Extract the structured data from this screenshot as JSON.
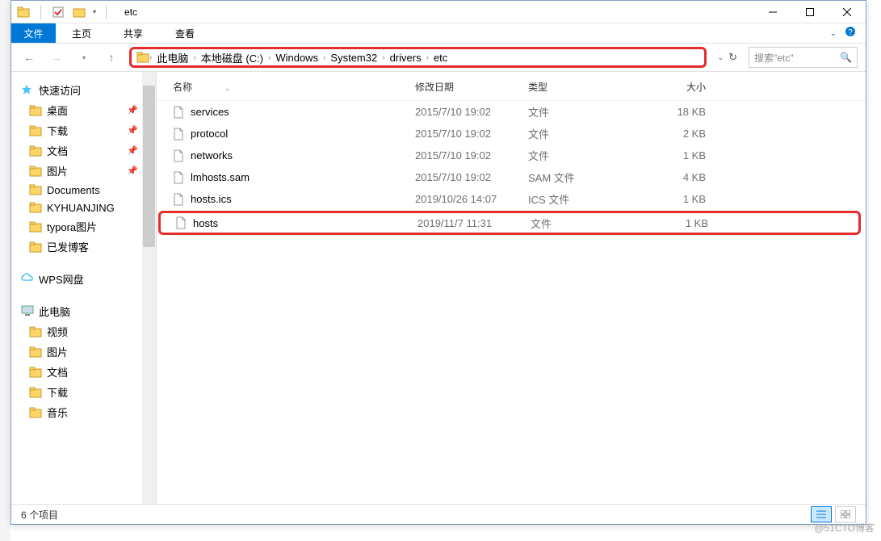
{
  "window": {
    "title": "etc"
  },
  "ribbon": {
    "file": "文件",
    "tabs": [
      "主页",
      "共享",
      "查看"
    ]
  },
  "nav": {
    "breadcrumb": [
      "此电脑",
      "本地磁盘 (C:)",
      "Windows",
      "System32",
      "drivers",
      "etc"
    ],
    "search_placeholder": "搜索\"etc\""
  },
  "sidebar": {
    "quick_access": {
      "label": "快速访问",
      "items": [
        {
          "label": "桌面",
          "pinned": true,
          "icon": "desktop"
        },
        {
          "label": "下载",
          "pinned": true,
          "icon": "downloads"
        },
        {
          "label": "文档",
          "pinned": true,
          "icon": "documents"
        },
        {
          "label": "图片",
          "pinned": true,
          "icon": "pictures"
        },
        {
          "label": "Documents",
          "pinned": false,
          "icon": "folder"
        },
        {
          "label": "KYHUANJING",
          "pinned": false,
          "icon": "folder"
        },
        {
          "label": "typora图片",
          "pinned": false,
          "icon": "folder"
        },
        {
          "label": "已发博客",
          "pinned": false,
          "icon": "folder"
        }
      ]
    },
    "wps": {
      "label": "WPS网盘"
    },
    "this_pc": {
      "label": "此电脑",
      "items": [
        {
          "label": "视频",
          "icon": "video"
        },
        {
          "label": "图片",
          "icon": "pictures"
        },
        {
          "label": "文档",
          "icon": "documents"
        },
        {
          "label": "下载",
          "icon": "downloads"
        },
        {
          "label": "音乐",
          "icon": "music"
        }
      ]
    }
  },
  "columns": {
    "name": "名称",
    "date": "修改日期",
    "type": "类型",
    "size": "大小"
  },
  "files": [
    {
      "name": "services",
      "date": "2015/7/10 19:02",
      "type": "文件",
      "size": "18 KB",
      "highlighted": false
    },
    {
      "name": "protocol",
      "date": "2015/7/10 19:02",
      "type": "文件",
      "size": "2 KB",
      "highlighted": false
    },
    {
      "name": "networks",
      "date": "2015/7/10 19:02",
      "type": "文件",
      "size": "1 KB",
      "highlighted": false
    },
    {
      "name": "lmhosts.sam",
      "date": "2015/7/10 19:02",
      "type": "SAM 文件",
      "size": "4 KB",
      "highlighted": false
    },
    {
      "name": "hosts.ics",
      "date": "2019/10/26 14:07",
      "type": "ICS 文件",
      "size": "1 KB",
      "highlighted": false
    },
    {
      "name": "hosts",
      "date": "2019/11/7 11:31",
      "type": "文件",
      "size": "1 KB",
      "highlighted": true
    }
  ],
  "status": {
    "count_label": "6 个项目"
  },
  "watermark": "@51CTO博客"
}
